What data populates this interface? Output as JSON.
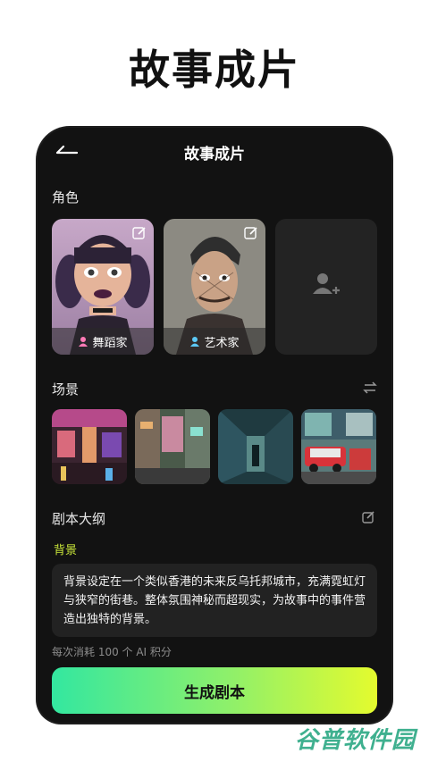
{
  "promo": {
    "title": "故事成片"
  },
  "screen": {
    "title": "故事成片"
  },
  "characters": {
    "label": "角色",
    "items": [
      {
        "name": "舞蹈家"
      },
      {
        "name": "艺术家"
      }
    ]
  },
  "scenes": {
    "label": "场景"
  },
  "outline": {
    "label": "剧本大纲",
    "background_label": "背景",
    "background_text": "背景设定在一个类似香港的未来反乌托邦城市，充满霓虹灯与狭窄的街巷。整体氛围神秘而超现实，为故事中的事件营造出独特的背景。"
  },
  "cost_note": "每次消耗 100 个 AI 积分",
  "generate_button": "生成剧本",
  "watermark": "谷普软件园",
  "colors": {
    "accent": "#c9e63a",
    "gradient_start": "#33e7a0",
    "gradient_end": "#e4fb2e"
  }
}
